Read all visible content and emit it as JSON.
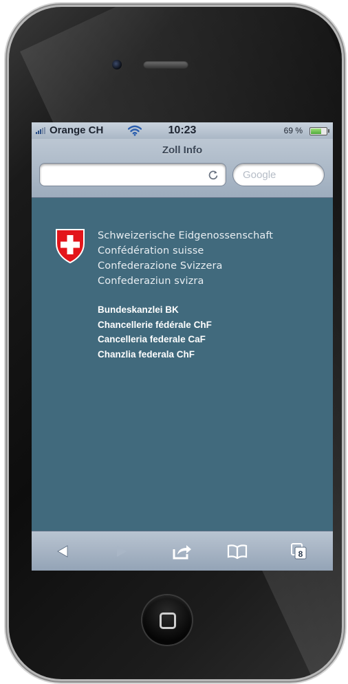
{
  "status_bar": {
    "carrier": "Orange CH",
    "time": "10:23",
    "battery": "69 %"
  },
  "browser": {
    "page_title": "Zoll Info",
    "url_value": "",
    "search_placeholder": "Google",
    "tabs_count": "8"
  },
  "page": {
    "authority_lines": [
      "Schweizerische Eidgenossenschaft",
      "Confédération suisse",
      "Confederazione Svizzera",
      "Confederaziun svizra"
    ],
    "chancellery_lines": [
      "Bundeskanzlei BK",
      "Chancellerie fédérale ChF",
      "Cancelleria federale CaF",
      "Chanzlia federala ChF"
    ]
  },
  "colors": {
    "page_background": "#416a7d",
    "swiss_red": "#e3151b"
  },
  "icons": {
    "toolbar": [
      "back-icon",
      "forward-icon",
      "share-icon",
      "bookmarks-icon",
      "tabs-icon"
    ],
    "header": [
      "signal-icon",
      "wifi-icon",
      "battery-icon",
      "reload-icon"
    ],
    "logo": "swiss-cross-shield-icon"
  }
}
